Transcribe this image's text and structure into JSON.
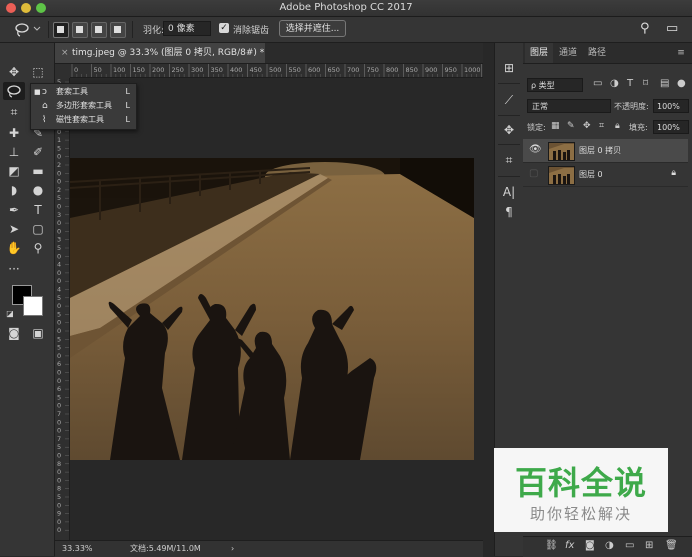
{
  "window": {
    "title": "Adobe Photoshop CC 2017"
  },
  "options_bar": {
    "feather_label": "羽化:",
    "feather_value": "0 像素",
    "antialias_label": "消除锯齿",
    "antialias_checked": true,
    "select_mask_button": "选择并遮住..."
  },
  "document": {
    "tab_label": "timg.jpeg @ 33.3% (图层 0 拷贝, RGB/8#) *",
    "close_glyph": "×"
  },
  "ruler": {
    "h_ticks": [
      "0",
      "50",
      "100",
      "150",
      "200",
      "250",
      "300",
      "350",
      "400",
      "450",
      "500",
      "550",
      "600",
      "650",
      "700",
      "750",
      "800",
      "850",
      "900",
      "950",
      "1000",
      "105"
    ],
    "v_ticks": [
      "5",
      "0",
      "5",
      "0",
      "1",
      "0",
      "0",
      "1",
      "5",
      "0",
      "2",
      "0",
      "0",
      "2",
      "5",
      "0",
      "3",
      "0",
      "0",
      "3",
      "5",
      "0",
      "4",
      "0",
      "0",
      "4",
      "5",
      "0",
      "5",
      "0",
      "0",
      "5",
      "5",
      "0",
      "6",
      "0",
      "0",
      "6",
      "5",
      "0",
      "7",
      "0",
      "0",
      "7",
      "5",
      "0",
      "8",
      "0",
      "0",
      "8",
      "5",
      "0",
      "9",
      "0",
      "0"
    ]
  },
  "tool_flyout": {
    "items": [
      {
        "label": "套索工具",
        "key": "L",
        "icon": "lasso-icon",
        "selected": true
      },
      {
        "label": "多边形套索工具",
        "key": "L",
        "icon": "polygonal-lasso-icon",
        "selected": false
      },
      {
        "label": "磁性套索工具",
        "key": "L",
        "icon": "magnetic-lasso-icon",
        "selected": false
      }
    ]
  },
  "status_bar": {
    "zoom": "33.33%",
    "doc_info": "文档:5.49M/11.0M",
    "arrow": "›"
  },
  "layers_panel": {
    "tabs": [
      "图层",
      "通道",
      "路径"
    ],
    "active_tab": "图层",
    "filter_kind": "ρ 类型",
    "blend_mode": "正常",
    "opacity_label": "不透明度:",
    "opacity_value": "100%",
    "lock_label": "锁定:",
    "fill_label": "填充:",
    "fill_value": "100%",
    "layers": [
      {
        "name": "图层 0 拷贝",
        "visible": true,
        "selected": true,
        "locked": false
      },
      {
        "name": "图层 0",
        "visible": false,
        "selected": false,
        "locked": true
      }
    ],
    "footer_fx": "fx"
  },
  "watermark": {
    "main": "百科全说",
    "sub": "助你轻松解决"
  },
  "colors": {
    "foreground": "#000000",
    "background": "#ffffff",
    "watermark_green": "#3ea94a"
  }
}
